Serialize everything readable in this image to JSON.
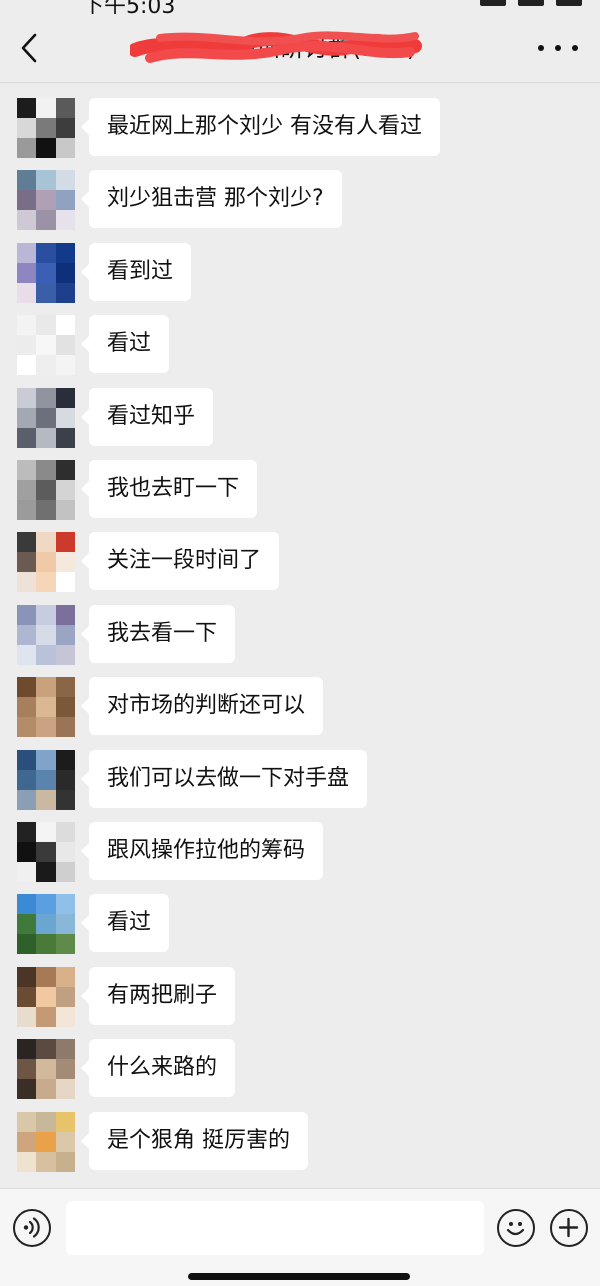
{
  "status_bar": {
    "time": "下午5:03"
  },
  "header": {
    "title": "证券深圳研讨群(126)",
    "back_icon": "chevron-left-icon",
    "more_icon": "more-dots-icon"
  },
  "messages": [
    {
      "text": "最近网上那个刘少 有没有人看过",
      "colors": [
        "#1c1c1c",
        "#f2f2f2",
        "#5a5a5a",
        "#d8d8d8",
        "#7a7a7a",
        "#3d3d3d",
        "#9a9a9a",
        "#111111",
        "#c8c8c8"
      ]
    },
    {
      "text": "刘少狙击营 那个刘少?",
      "colors": [
        "#5f7d95",
        "#a9c3d6",
        "#d3dbe6",
        "#7a6d87",
        "#b0a0b5",
        "#8fa2c0",
        "#cfc9d6",
        "#9c92a8",
        "#e6e1ea"
      ]
    },
    {
      "text": "看到过",
      "colors": [
        "#b9b7d6",
        "#2b4fa0",
        "#123a8a",
        "#8d86c0",
        "#3c5fb6",
        "#0e2f7a",
        "#e8dde8",
        "#3a5fa8",
        "#1d3f8c"
      ]
    },
    {
      "text": "看过",
      "colors": [
        "#f3f3f3",
        "#e9e9e9",
        "#ffffff",
        "#ececec",
        "#f7f7f7",
        "#e2e2e2",
        "#ffffff",
        "#eeeeee",
        "#f4f4f4"
      ]
    },
    {
      "text": "看过知乎",
      "colors": [
        "#c9ccd4",
        "#8f949f",
        "#2a2e3a",
        "#a3a8b2",
        "#6b707c",
        "#d7dae0",
        "#5a5f6b",
        "#b5b9c2",
        "#3c404b"
      ]
    },
    {
      "text": "我也去盯一下",
      "colors": [
        "#bcbcbc",
        "#8a8a8a",
        "#2e2e2e",
        "#a0a0a0",
        "#5c5c5c",
        "#d4d4d4",
        "#9b9b9b",
        "#707070",
        "#c2c2c2"
      ]
    },
    {
      "text": "关注一段时间了",
      "colors": [
        "#3a3a3a",
        "#f0d9c4",
        "#cc3a2b",
        "#6a5a52",
        "#efc9a8",
        "#f5e8dc",
        "#eee2d8",
        "#f7d5b8",
        "#ffffff"
      ]
    },
    {
      "text": "我去看一下",
      "colors": [
        "#8a93b8",
        "#c7cde0",
        "#7b6f9e",
        "#aeb7cf",
        "#d6dbe8",
        "#9aa4c3",
        "#dfe4ef",
        "#b9c2d8",
        "#c5c5d5"
      ]
    },
    {
      "text": "对市场的判断还可以",
      "colors": [
        "#6e4a2f",
        "#c9a27d",
        "#8b6646",
        "#a87f5c",
        "#d9b893",
        "#7d5838",
        "#b48c6a",
        "#caa482",
        "#9a7454"
      ]
    },
    {
      "text": "我们可以去做一下对手盘",
      "colors": [
        "#2b4f7c",
        "#7fa3c9",
        "#1c1c1c",
        "#3e6892",
        "#5a84ad",
        "#2a2a2a",
        "#8a9fb3",
        "#c9b8a2",
        "#333333"
      ]
    },
    {
      "text": "跟风操作拉他的筹码",
      "colors": [
        "#222222",
        "#f4f4f4",
        "#dcdcdc",
        "#111111",
        "#3a3a3a",
        "#e8e8e8",
        "#f0f0f0",
        "#1a1a1a",
        "#cfcfcf"
      ]
    },
    {
      "text": "看过",
      "colors": [
        "#3b8ad6",
        "#5aa0e0",
        "#8ec0ea",
        "#3f7a3a",
        "#6aa6cf",
        "#88b7d8",
        "#2f5f2a",
        "#4a7a3a",
        "#5e8a4a"
      ]
    },
    {
      "text": "有两把刷子",
      "colors": [
        "#4a3526",
        "#a57a55",
        "#d8b08a",
        "#6b4b34",
        "#f0c9a2",
        "#bfa083",
        "#e8dccf",
        "#c49a76",
        "#f3e6d8"
      ]
    },
    {
      "text": "什么来路的",
      "colors": [
        "#2a2523",
        "#5a4a40",
        "#8e7a6a",
        "#6e5644",
        "#d3b99c",
        "#a48b76",
        "#3a2e26",
        "#c8ab8d",
        "#e5d6c5"
      ]
    },
    {
      "text": "是个狠角 挺厉害的",
      "colors": [
        "#d9c8a8",
        "#c9b79a",
        "#e7c36a",
        "#cfa57e",
        "#e9a24a",
        "#dcc8a8",
        "#efe3cf",
        "#d6c0a0",
        "#c7b18d"
      ]
    }
  ],
  "input": {
    "placeholder": "",
    "value": ""
  },
  "icons": {
    "voice": "voice-icon",
    "emoji": "emoji-icon",
    "plus": "plus-icon"
  }
}
